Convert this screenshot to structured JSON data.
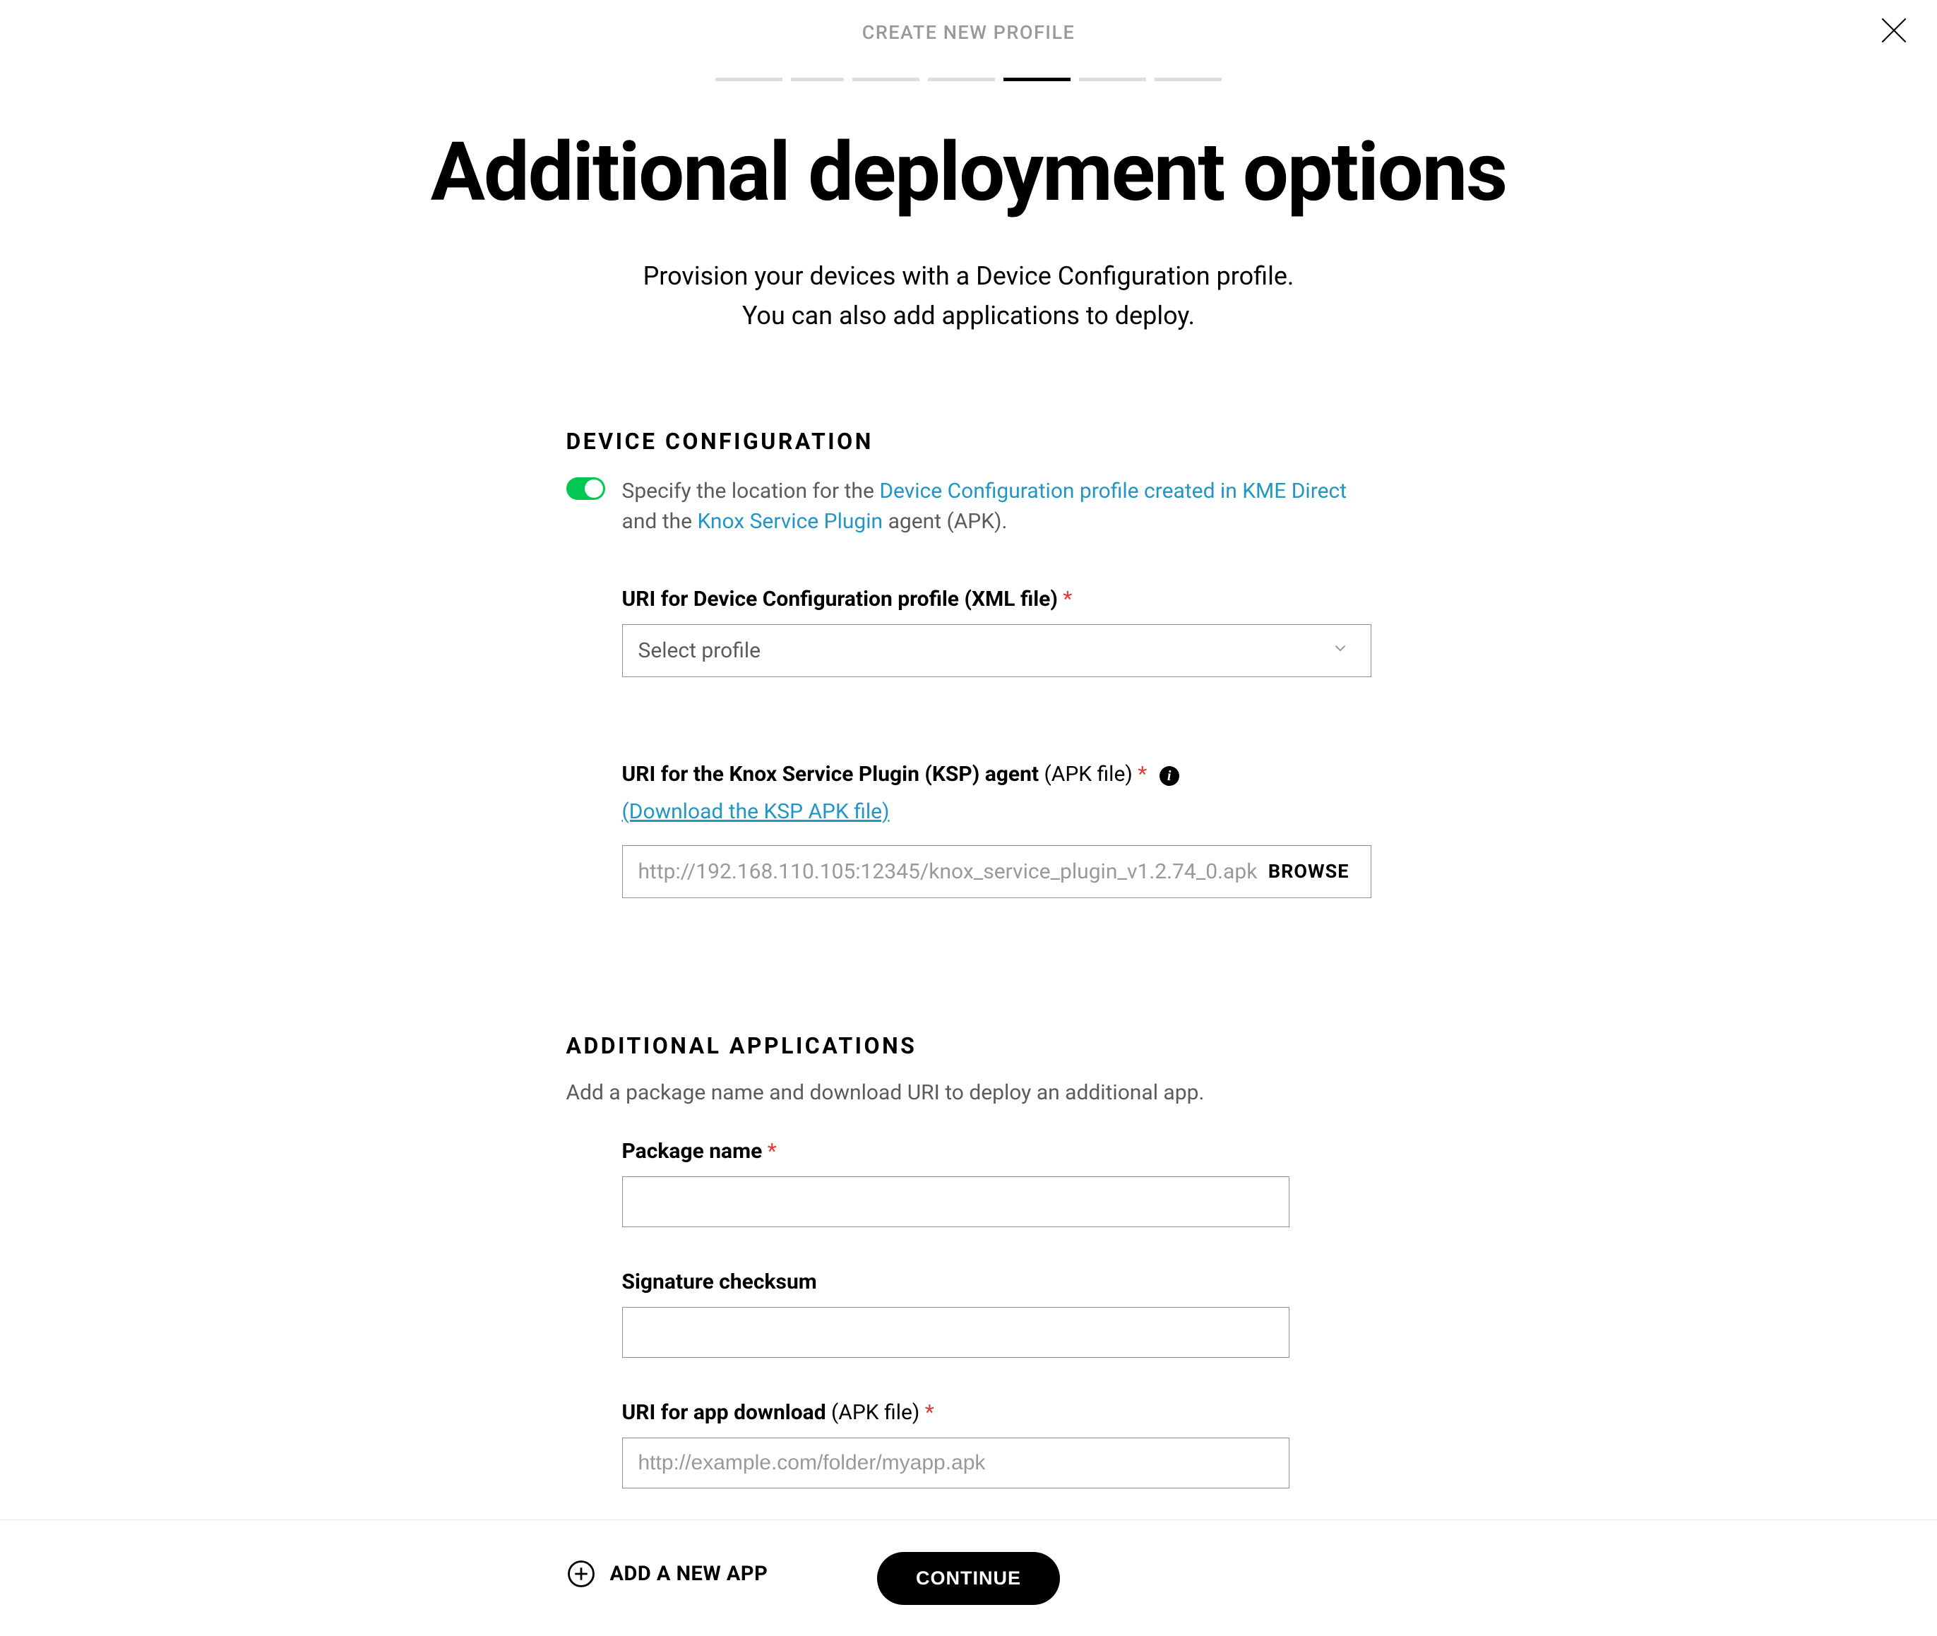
{
  "header": {
    "label": "CREATE NEW PROFILE"
  },
  "title": "Additional deployment options",
  "subtitle_line1": "Provision your devices with a Device Configuration profile.",
  "subtitle_line2": "You can also add applications to deploy.",
  "device_config": {
    "heading": "DEVICE CONFIGURATION",
    "desc_pre": "Specify the location for the ",
    "link1": "Device Configuration profile created in KME Direct",
    "desc_mid": " and the ",
    "link2": "Knox Service Plugin",
    "desc_post": " agent (APK).",
    "uri_xml_label": "URI for Device Configuration profile (XML file)",
    "select_placeholder": "Select profile",
    "uri_ksp_label_bold": "URI for the Knox Service Plugin (KSP) agent",
    "uri_ksp_label_thin": " (APK file)",
    "download_link": "(Download the KSP APK file)",
    "ksp_value": "http://192.168.110.105:12345/knox_service_plugin_v1.2.74_0.apk",
    "browse_label": "BROWSE"
  },
  "apps": {
    "heading": "ADDITIONAL APPLICATIONS",
    "desc": "Add a package name and download URI to deploy an additional app.",
    "package_label": "Package name",
    "checksum_label": "Signature checksum",
    "uri_label_bold": "URI for app download",
    "uri_label_thin": " (APK file)",
    "uri_placeholder": "http://example.com/folder/myapp.apk",
    "add_label": "ADD A NEW APP"
  },
  "footer": {
    "continue": "CONTINUE"
  }
}
